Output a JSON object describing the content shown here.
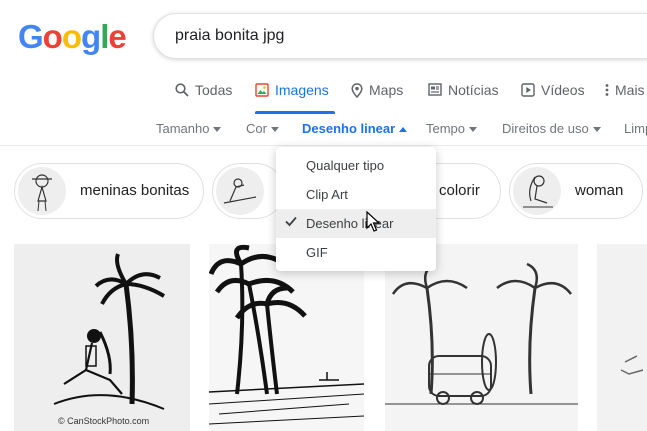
{
  "logo": {
    "l1": "G",
    "l2": "o",
    "l3": "o",
    "l4": "g",
    "l5": "l",
    "l6": "e"
  },
  "search": {
    "query": "praia bonita jpg"
  },
  "tabs": [
    {
      "label": "Todas",
      "icon": "search-icon"
    },
    {
      "label": "Imagens",
      "icon": "image-icon",
      "active": true
    },
    {
      "label": "Maps",
      "icon": "map-pin-icon"
    },
    {
      "label": "Notícias",
      "icon": "newspaper-icon"
    },
    {
      "label": "Vídeos",
      "icon": "play-icon"
    },
    {
      "label": "Mais",
      "icon": "more-vert-icon"
    }
  ],
  "filters": [
    {
      "label": "Tamanho"
    },
    {
      "label": "Cor"
    },
    {
      "label": "Desenho linear",
      "active": true
    },
    {
      "label": "Tempo"
    },
    {
      "label": "Direitos de uso"
    },
    {
      "label": "Limp"
    }
  ],
  "chips": [
    {
      "label": "meninas bonitas"
    },
    {
      "label": ""
    },
    {
      "label": "colorir"
    },
    {
      "label": "woman"
    }
  ],
  "menu": {
    "items": [
      {
        "label": "Qualquer tipo"
      },
      {
        "label": "Clip Art"
      },
      {
        "label": "Desenho linear",
        "selected": true
      },
      {
        "label": "GIF"
      }
    ]
  },
  "results": [
    {
      "watermark": "© CanStockPhoto.com"
    },
    {
      "watermark": ""
    },
    {
      "watermark": ""
    },
    {
      "watermark": ""
    }
  ],
  "colors": {
    "accent": "#1a73e8",
    "muted": "#5f6368"
  }
}
